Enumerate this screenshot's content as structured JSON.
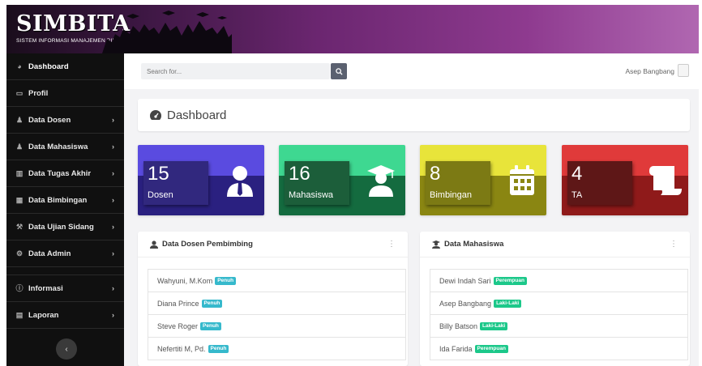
{
  "app": {
    "logo": "SIMBITA",
    "tagline": "SISTEM INFORMASI MANAJEMEN BIMBINGAN TUGAS AKHIR"
  },
  "sidebar": {
    "items": [
      {
        "label": "Dashboard",
        "icon": "gauge-icon",
        "chevron": false
      },
      {
        "label": "Profil",
        "icon": "id-card-icon",
        "chevron": false
      },
      {
        "label": "Data Dosen",
        "icon": "user-tie-icon",
        "chevron": true
      },
      {
        "label": "Data Mahasiswa",
        "icon": "user-graduate-icon",
        "chevron": true
      },
      {
        "label": "Data Tugas Akhir",
        "icon": "book-icon",
        "chevron": true
      },
      {
        "label": "Data Bimbingan",
        "icon": "calendar-icon",
        "chevron": true
      },
      {
        "label": "Data Ujian Sidang",
        "icon": "gavel-icon",
        "chevron": true
      },
      {
        "label": "Data Admin",
        "icon": "users-cog-icon",
        "chevron": true
      },
      {
        "label": "Informasi",
        "icon": "info-circle-icon",
        "chevron": true
      },
      {
        "label": "Laporan",
        "icon": "file-icon",
        "chevron": true
      }
    ],
    "toggle_glyph": "‹"
  },
  "topbar": {
    "search_placeholder": "Search for...",
    "user_name": "Asep Bangbang"
  },
  "page": {
    "title": "Dashboard"
  },
  "stats": [
    {
      "value": "15",
      "label": "Dosen",
      "icon": "user-tie-icon"
    },
    {
      "value": "16",
      "label": "Mahasiswa",
      "icon": "graduation-cap-icon"
    },
    {
      "value": "8",
      "label": "Bimbingan",
      "icon": "calendar-icon"
    },
    {
      "value": "4",
      "label": "TA",
      "icon": "scroll-icon"
    }
  ],
  "panels": {
    "dosen": {
      "title": "Data Dosen Pembimbing",
      "rows": [
        {
          "name": "Wahyuni, M.Kom",
          "badge": "Penuh"
        },
        {
          "name": "Diana Prince",
          "badge": "Penuh"
        },
        {
          "name": "Steve Roger",
          "badge": "Penuh"
        },
        {
          "name": "Nefertiti M, Pd.",
          "badge": "Penuh"
        }
      ]
    },
    "mahasiswa": {
      "title": "Data Mahasiswa",
      "rows": [
        {
          "name": "Dewi Indah Sari",
          "badge": "Perempuan"
        },
        {
          "name": "Asep Bangbang",
          "badge": "Laki-Laki"
        },
        {
          "name": "Billy Batson",
          "badge": "Laki-Laki"
        },
        {
          "name": "Ida Farida",
          "badge": "Perempuan"
        }
      ]
    }
  },
  "colors": {
    "sidebar_bg": "#101010",
    "dosen_card": "#4e3fcf",
    "mahasiswa_card": "#2db36f",
    "bimbingan_card": "#c9c422",
    "ta_card": "#d52b2b",
    "badge_info": "#36b9cc",
    "badge_green": "#1cc88a"
  }
}
